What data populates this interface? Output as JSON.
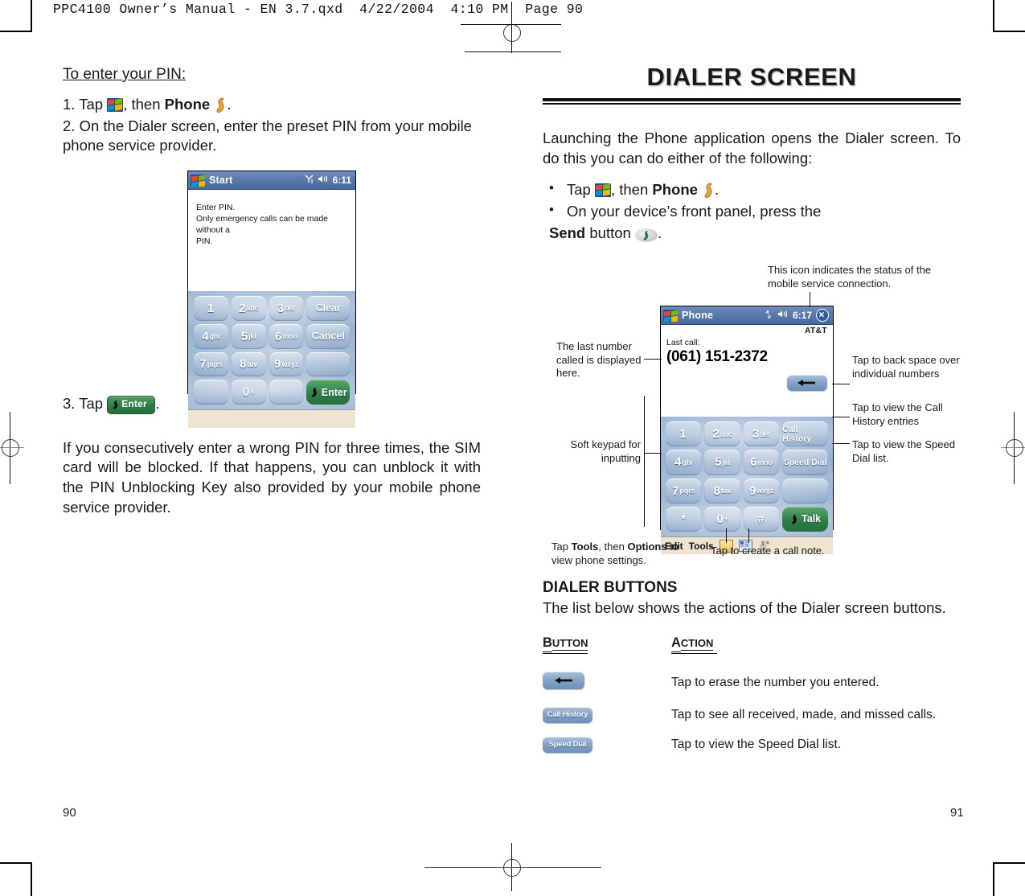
{
  "print_header": "PPC4100 Owner’s Manual - EN 3.7.qxd  4/22/2004  4:10 PM  Page 90",
  "left_page": {
    "number": "90",
    "heading": "To enter your PIN:",
    "step1_prefix": "1. Tap",
    "step1_mid": ", then",
    "step1_bold": "Phone",
    "step1_suffix": ".",
    "step2": "2. On the Dialer screen, enter the preset PIN from your mobile phone service provider.",
    "step3_prefix": "3. Tap",
    "step3_suffix": ".",
    "note": "If you consecutively enter a wrong PIN for three times, the SIM card will be blocked. If that happens, you can unblock it with the PIN Unblocking Key also provided by your mobile phone service provider.",
    "pin_screen": {
      "title": "Start",
      "time": "6:11",
      "prompt_line1": "Enter PIN.",
      "prompt_line2": "Only emergency calls can be made without a",
      "prompt_line3": "PIN.",
      "keys": [
        {
          "big": "1",
          "sml": ""
        },
        {
          "big": "2",
          "sml": "abc"
        },
        {
          "big": "3",
          "sml": "def"
        },
        {
          "wide": "Clear"
        },
        {
          "big": "4",
          "sml": "ghi"
        },
        {
          "big": "5",
          "sml": "jkl"
        },
        {
          "big": "6",
          "sml": "mno"
        },
        {
          "wide": "Cancel"
        },
        {
          "big": "7",
          "sml": "pqrs"
        },
        {
          "big": "8",
          "sml": "tuv"
        },
        {
          "big": "9",
          "sml": "wxyz"
        },
        {
          "wide": ""
        },
        {
          "big": "",
          "sml": ""
        },
        {
          "big": "0",
          "sml": "+"
        },
        {
          "big": "",
          "sml": ""
        },
        {
          "wide": "Enter",
          "green": true
        }
      ]
    }
  },
  "right_page": {
    "number": "91",
    "banner": "DIALER SCREEN",
    "intro": "Launching the Phone application opens the Dialer screen. To do this you can do either of the following:",
    "bullet1_prefix": "Tap",
    "bullet1_mid": ", then",
    "bullet1_bold": "Phone",
    "bullet1_suffix": ".",
    "bullet2_text": "On your device’s front panel, press the",
    "bullet2_bold": "Send",
    "bullet2_mid": "button",
    "bullet2_suffix": ".",
    "phone_screen": {
      "title": "Phone",
      "time": "6:17",
      "carrier": "AT&T",
      "last_call_label": "Last call:",
      "last_call_number": "(061) 151-2372",
      "keys": [
        {
          "big": "1",
          "sml": ""
        },
        {
          "big": "2",
          "sml": "abc"
        },
        {
          "big": "3",
          "sml": "def"
        },
        {
          "wide": "Call History"
        },
        {
          "big": "4",
          "sml": "ghi"
        },
        {
          "big": "5",
          "sml": "jkl"
        },
        {
          "big": "6",
          "sml": "mno"
        },
        {
          "wide": "Speed Dial"
        },
        {
          "big": "7",
          "sml": "pqrs"
        },
        {
          "big": "8",
          "sml": "tuv"
        },
        {
          "big": "9",
          "sml": "wxyz"
        },
        {
          "wide": ""
        },
        {
          "big": "*",
          "sml": ""
        },
        {
          "big": "0",
          "sml": "+"
        },
        {
          "big": "#",
          "sml": ""
        },
        {
          "wide": "Talk",
          "green": true
        }
      ],
      "menu_edit": "Edit",
      "menu_tools": "Tools"
    },
    "callouts": {
      "status_icon": "This icon indicates the status of the mobile service connection.",
      "last_number": "The last number called is displayed here.",
      "soft_keypad": "Soft keypad for inputting",
      "back_space": "Tap to back space over individual numbers",
      "call_history": "Tap to view the Call History entries",
      "speed_dial": "Tap to view the Speed Dial list.",
      "tools_options_prefix": "Tap",
      "tools_options_b1": "Tools",
      "tools_options_mid": ", then",
      "tools_options_b2": "Options",
      "tools_options_suffix": "to view phone settings.",
      "call_note": "Tap to create a call note."
    },
    "buttons_section": {
      "heading": "DIALER BUTTONS",
      "intro": "The list below shows the actions of the Dialer screen buttons.",
      "col_button_first": "B",
      "col_button_rest": "UTTON",
      "col_action_first": "A",
      "col_action_rest": "CTION",
      "rows": [
        {
          "icon": "backspace-chip",
          "label": "",
          "action": "Tap to erase the number you entered."
        },
        {
          "icon": "call-history-chip",
          "label": "Call History",
          "action": "Tap to see all received, made, and missed calls."
        },
        {
          "icon": "speed-dial-chip",
          "label": "Speed Dial",
          "action": "Tap to view the Speed Dial list."
        }
      ]
    }
  }
}
